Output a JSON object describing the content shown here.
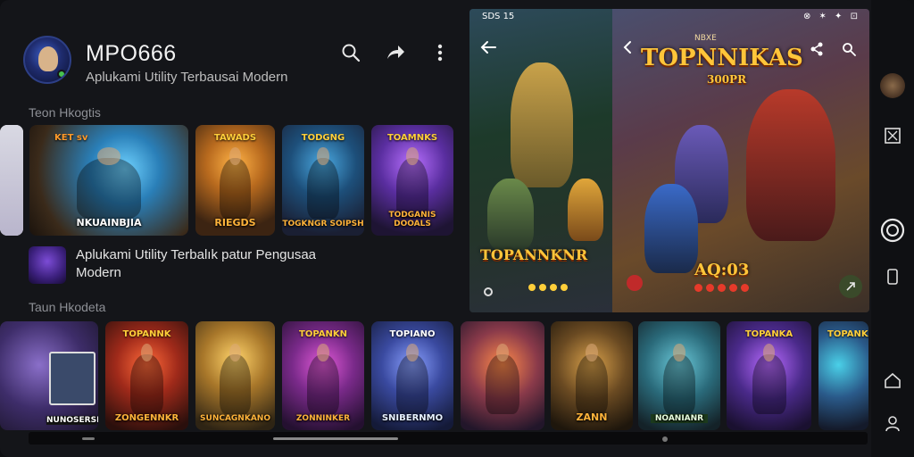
{
  "header": {
    "title": "MPO666",
    "subtitle": "Aplukami Utility Terbausai Modern",
    "icons": [
      "search-icon",
      "share-icon",
      "more-vert-icon"
    ]
  },
  "section1": {
    "label": "Teon Hkogtis",
    "cards": [
      {
        "logo": "",
        "caption": ""
      },
      {
        "logo": "KET sv",
        "caption": "NKUAINBJIA"
      },
      {
        "logo": "TAWADS",
        "caption": "RIEGDS"
      },
      {
        "logo": "TODGNG",
        "caption": "TOGKNGR SOIPSH"
      },
      {
        "logo": "TOAMNKS",
        "caption": "TODGANIS DOOALS"
      }
    ]
  },
  "middle": {
    "text": "Aplukami Utility Terbalık patur Pengusaa Modern"
  },
  "section2": {
    "label": "Taun Hkodeta",
    "cards": [
      {
        "logo": "",
        "caption": "NUNOSERSKK"
      },
      {
        "logo": "TOPANNK",
        "caption": "ZONGENNKR"
      },
      {
        "logo": "",
        "caption": "SUNCAGNKANO"
      },
      {
        "logo": "TOPANKN",
        "caption": "ZONNINKER"
      },
      {
        "logo": "TOPIANO",
        "caption": "SNIBERNMO"
      },
      {
        "logo": "",
        "caption": ""
      },
      {
        "logo": "",
        "caption": "ZANN"
      },
      {
        "logo": "",
        "caption": "NOANIANR"
      },
      {
        "logo": "TOPANKA",
        "caption": ""
      },
      {
        "logo": "TOPANKA",
        "caption": ""
      }
    ]
  },
  "panel": {
    "status_left": "SDS 15",
    "left_logo": "TOPANNKNR",
    "right_title": "TOPNNIKAS",
    "right_sub": "300PR",
    "right_top_small": "NBXE",
    "score": "AQ:03",
    "status_right": "⊗ ✶ ✦ ⊡"
  },
  "colors": {
    "accent": "#ffc53a",
    "background": "#141519",
    "online": "#47c24f"
  }
}
